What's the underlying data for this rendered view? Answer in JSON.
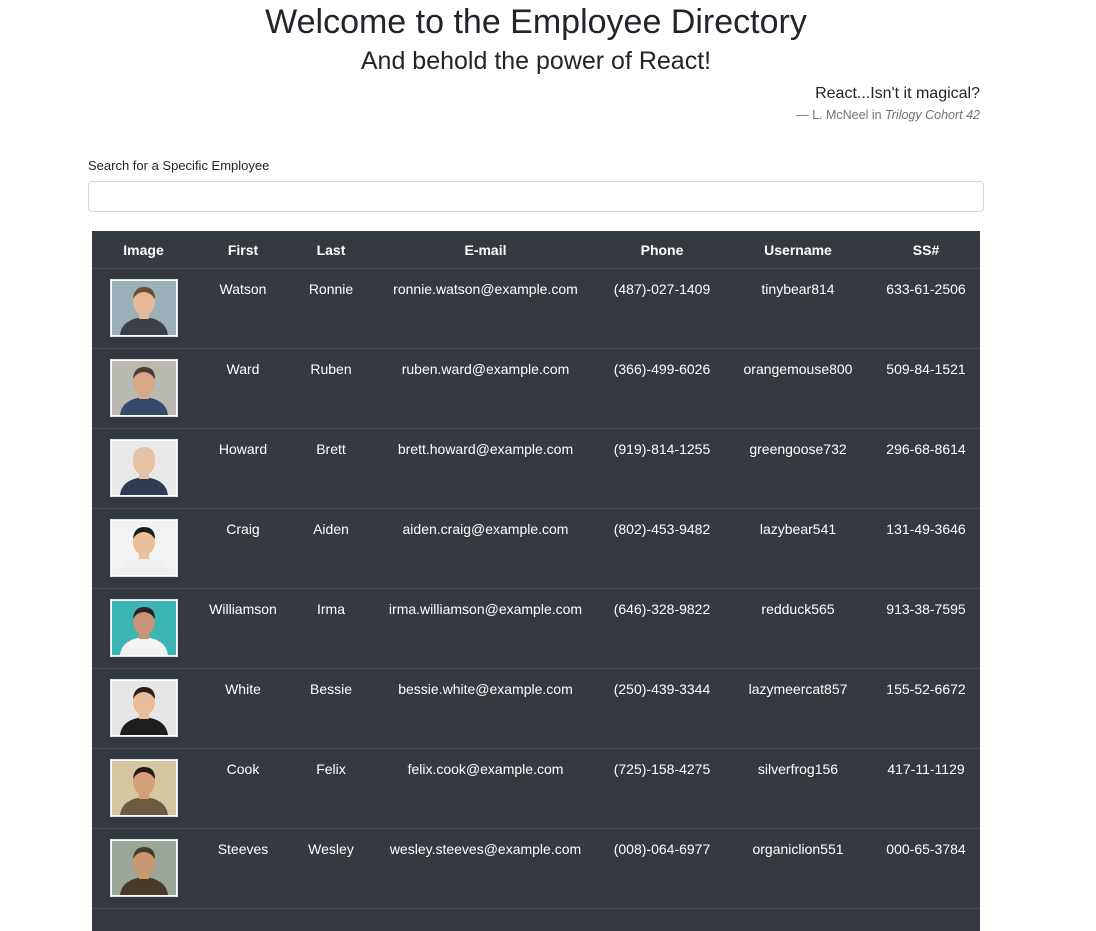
{
  "header": {
    "title": "Welcome to the Employee Directory",
    "subtitle": "And behold the power of React!",
    "quote": "React...Isn't it magical?",
    "quote_author": "— L. McNeel in ",
    "quote_source": "Trilogy Cohort 42"
  },
  "search": {
    "label": "Search for a Specific Employee",
    "value": "",
    "placeholder": ""
  },
  "table": {
    "columns": [
      "Image",
      "First",
      "Last",
      "E-mail",
      "Phone",
      "Username",
      "SS#"
    ],
    "rows": [
      {
        "first": "Watson",
        "last": "Ronnie",
        "email": "ronnie.watson@example.com",
        "phone": "(487)-027-1409",
        "username": "tinybear814",
        "ssn": "633-61-2506",
        "photo": {
          "bg": "#9ab0b8",
          "skin": "#e2b896",
          "hair": "#6a4a32",
          "shirt": "#3a3f48"
        }
      },
      {
        "first": "Ward",
        "last": "Ruben",
        "email": "ruben.ward@example.com",
        "phone": "(366)-499-6026",
        "username": "orangemouse800",
        "ssn": "509-84-1521",
        "photo": {
          "bg": "#b9b9b1",
          "skin": "#d8a688",
          "hair": "#4a3a30",
          "shirt": "#344a6a"
        }
      },
      {
        "first": "Howard",
        "last": "Brett",
        "email": "brett.howard@example.com",
        "phone": "(919)-814-1255",
        "username": "greengoose732",
        "ssn": "296-68-8614",
        "photo": {
          "bg": "#e9e9e9",
          "skin": "#e6c2a6",
          "hair": "#e6c2a6",
          "shirt": "#2e3b52"
        }
      },
      {
        "first": "Craig",
        "last": "Aiden",
        "email": "aiden.craig@example.com",
        "phone": "(802)-453-9482",
        "username": "lazybear541",
        "ssn": "131-49-3646",
        "photo": {
          "bg": "#f2f2f2",
          "skin": "#e8c09a",
          "hair": "#1c1c1c",
          "shirt": "#efefef"
        }
      },
      {
        "first": "Williamson",
        "last": "Irma",
        "email": "irma.williamson@example.com",
        "phone": "(646)-328-9822",
        "username": "redduck565",
        "ssn": "913-38-7595",
        "photo": {
          "bg": "#3cb5b5",
          "skin": "#c69478",
          "hair": "#2a221e",
          "shirt": "#f2f2f2"
        }
      },
      {
        "first": "White",
        "last": "Bessie",
        "email": "bessie.white@example.com",
        "phone": "(250)-439-3344",
        "username": "lazymeercat857",
        "ssn": "155-52-6672",
        "photo": {
          "bg": "#e6e6e6",
          "skin": "#e6bc9c",
          "hair": "#2c1f18",
          "shirt": "#1e1e1e"
        }
      },
      {
        "first": "Cook",
        "last": "Felix",
        "email": "felix.cook@example.com",
        "phone": "(725)-158-4275",
        "username": "silverfrog156",
        "ssn": "417-11-1129",
        "photo": {
          "bg": "#d6c6a0",
          "skin": "#d4a07c",
          "hair": "#241a14",
          "shirt": "#6e5a40"
        }
      },
      {
        "first": "Steeves",
        "last": "Wesley",
        "email": "wesley.steeves@example.com",
        "phone": "(008)-064-6977",
        "username": "organiclion551",
        "ssn": "000-65-3784",
        "photo": {
          "bg": "#9aa69a",
          "skin": "#c9986e",
          "hair": "#4a3a28",
          "shirt": "#4a3a28"
        }
      }
    ]
  }
}
